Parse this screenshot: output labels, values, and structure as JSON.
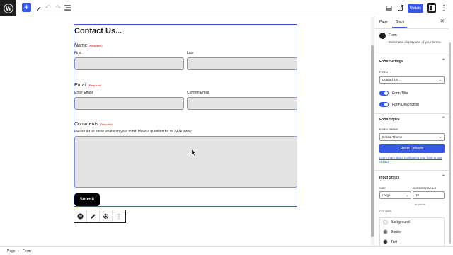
{
  "toolbar": {
    "update_label": "Update"
  },
  "canvas": {
    "title": "Contact Us...",
    "name_label": "Name",
    "required": "(Required)",
    "first_label": "First",
    "last_label": "Last",
    "email_label": "Email",
    "enter_email": "Enter Email",
    "confirm_email": "Confirm Email",
    "comments_label": "Comments",
    "comments_desc": "Please let us know what's on your mind. Have a question for us? Ask away.",
    "submit_label": "Submit"
  },
  "sidebar": {
    "tab_page": "Page",
    "tab_block": "Block",
    "block_name": "Form",
    "block_desc": "Select and display one of your forms.",
    "form_settings": "Form Settings",
    "form_label": "FORM",
    "form_value": "Contact Us...",
    "form_title_toggle": "Form Title",
    "form_desc_toggle": "Form Description",
    "form_styles": "Form Styles",
    "form_theme_label": "FORM THEME",
    "form_theme_value": "Orbital Theme",
    "reset_defaults": "Reset Defaults",
    "learn_more": "Learn more about configuring your form to use Orbital.",
    "input_styles": "Input Styles",
    "size_label": "SIZE",
    "size_value": "Large",
    "border_radius_label": "BORDER RADIUS",
    "border_radius_value": "10",
    "border_radius_unit": "In pixels",
    "colors_label": "COLORS",
    "color_items": [
      "Background",
      "Border",
      "Text"
    ],
    "colors": {
      "background": "#f0f0f0",
      "border": "#757575",
      "text": "#1d2327"
    }
  },
  "statusbar": {
    "crumb_page": "Page",
    "crumb_sep": "›",
    "crumb_form": "Form"
  },
  "accent": "#3858e9"
}
